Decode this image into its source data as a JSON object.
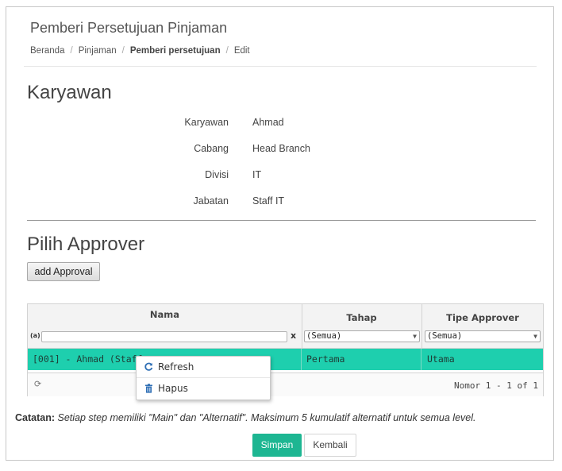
{
  "header": {
    "title": "Pemberi Persetujuan Pinjaman",
    "breadcrumb": [
      "Beranda",
      "Pinjaman",
      "Pemberi persetujuan",
      "Edit"
    ]
  },
  "karyawan": {
    "title": "Karyawan",
    "fields": [
      {
        "label": "Karyawan",
        "value": "Ahmad"
      },
      {
        "label": "Cabang",
        "value": "Head Branch"
      },
      {
        "label": "Divisi",
        "value": "IT"
      },
      {
        "label": "Jabatan",
        "value": "Staff IT"
      }
    ]
  },
  "approver": {
    "title": "Pilih Approver",
    "add_button": "add Approval",
    "grid": {
      "columns": [
        "Nama",
        "Tahap",
        "Tipe Approver"
      ],
      "filters": {
        "clear": "x",
        "tahap": "(Semua)",
        "tipe": "(Semua)"
      },
      "rows": [
        {
          "nama": "[001] - Ahmad (Staff -",
          "tahap": "Pertama",
          "tipe": "Utama"
        }
      ],
      "pager": "Nomor 1 - 1 of 1",
      "row_color": "#1ecfae"
    },
    "context_menu": [
      {
        "label": "Refresh",
        "icon": "refresh-icon"
      },
      {
        "label": "Hapus",
        "icon": "trash-icon"
      }
    ]
  },
  "note": {
    "label": "Catatan:",
    "text": "Setiap step memiliki \"Main\" dan \"Alternatif\". Maksimum 5 kumulatif alternatif untuk semua level."
  },
  "actions": {
    "save": "Simpan",
    "back": "Kembali",
    "save_color": "#1db692"
  }
}
